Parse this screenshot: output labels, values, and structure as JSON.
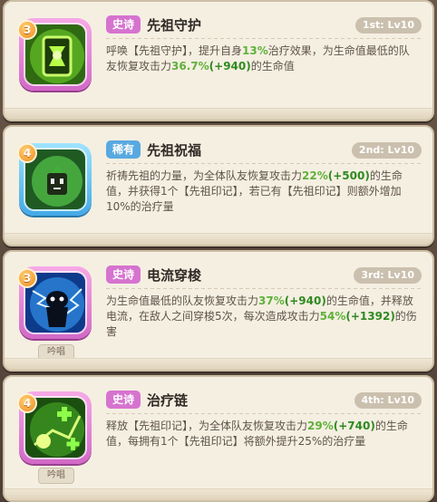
{
  "skills": [
    {
      "level": "3",
      "rarity": "史诗",
      "name": "先祖守护",
      "lvl": "1st: Lv10",
      "desc": [
        {
          "t": "呼唤【先祖守护】，提升自身",
          "c": ""
        },
        {
          "t": "13%",
          "c": "hl"
        },
        {
          "t": "治疗效果，为生命值最低的队友恢复攻击力",
          "c": ""
        },
        {
          "t": "36.7%",
          "c": "hl"
        },
        {
          "t": "(+940)",
          "c": "hlb"
        },
        {
          "t": "的生命值",
          "c": ""
        }
      ],
      "chant": ""
    },
    {
      "level": "4",
      "rarity": "稀有",
      "name": "先祖祝福",
      "lvl": "2nd: Lv10",
      "desc": [
        {
          "t": "祈祷先祖的力量，为全体队友恢复攻击力",
          "c": ""
        },
        {
          "t": "22%",
          "c": "hl"
        },
        {
          "t": "(+500)",
          "c": "hlb"
        },
        {
          "t": "的生命值，并获得1个【先祖印记】，若已有【先祖印记】则额外增加10%的治疗量",
          "c": ""
        }
      ],
      "chant": ""
    },
    {
      "level": "3",
      "rarity": "史诗",
      "name": "电流穿梭",
      "lvl": "3rd: Lv10",
      "desc": [
        {
          "t": "为生命值最低的队友恢复攻击力",
          "c": ""
        },
        {
          "t": "37%",
          "c": "hl"
        },
        {
          "t": "(+940)",
          "c": "hlb"
        },
        {
          "t": "的生命值，并释放电流，在敌人之间穿梭5次，每次造成攻击力",
          "c": ""
        },
        {
          "t": "54%",
          "c": "hl"
        },
        {
          "t": "(+1392)",
          "c": "hlb"
        },
        {
          "t": "的伤害",
          "c": ""
        }
      ],
      "chant": "吟唱"
    },
    {
      "level": "4",
      "rarity": "史诗",
      "name": "治疗链",
      "lvl": "4th: Lv10",
      "desc": [
        {
          "t": "释放【先祖印记】，为全体队友恢复攻击力",
          "c": ""
        },
        {
          "t": "29%",
          "c": "hl"
        },
        {
          "t": "(+740)",
          "c": "hlb"
        },
        {
          "t": "的生命值，每拥有1个【先祖印记】将额外提升25%的治疗量",
          "c": ""
        }
      ],
      "chant": "吟唱"
    }
  ],
  "colors": {
    "epic": "#d673cf",
    "rare": "#58a9e0",
    "highlight": "#5fb13b"
  },
  "icons": [
    "ancestor-shield-icon",
    "ancestor-spirit-icon",
    "electric-shadow-icon",
    "healing-chain-icon"
  ]
}
